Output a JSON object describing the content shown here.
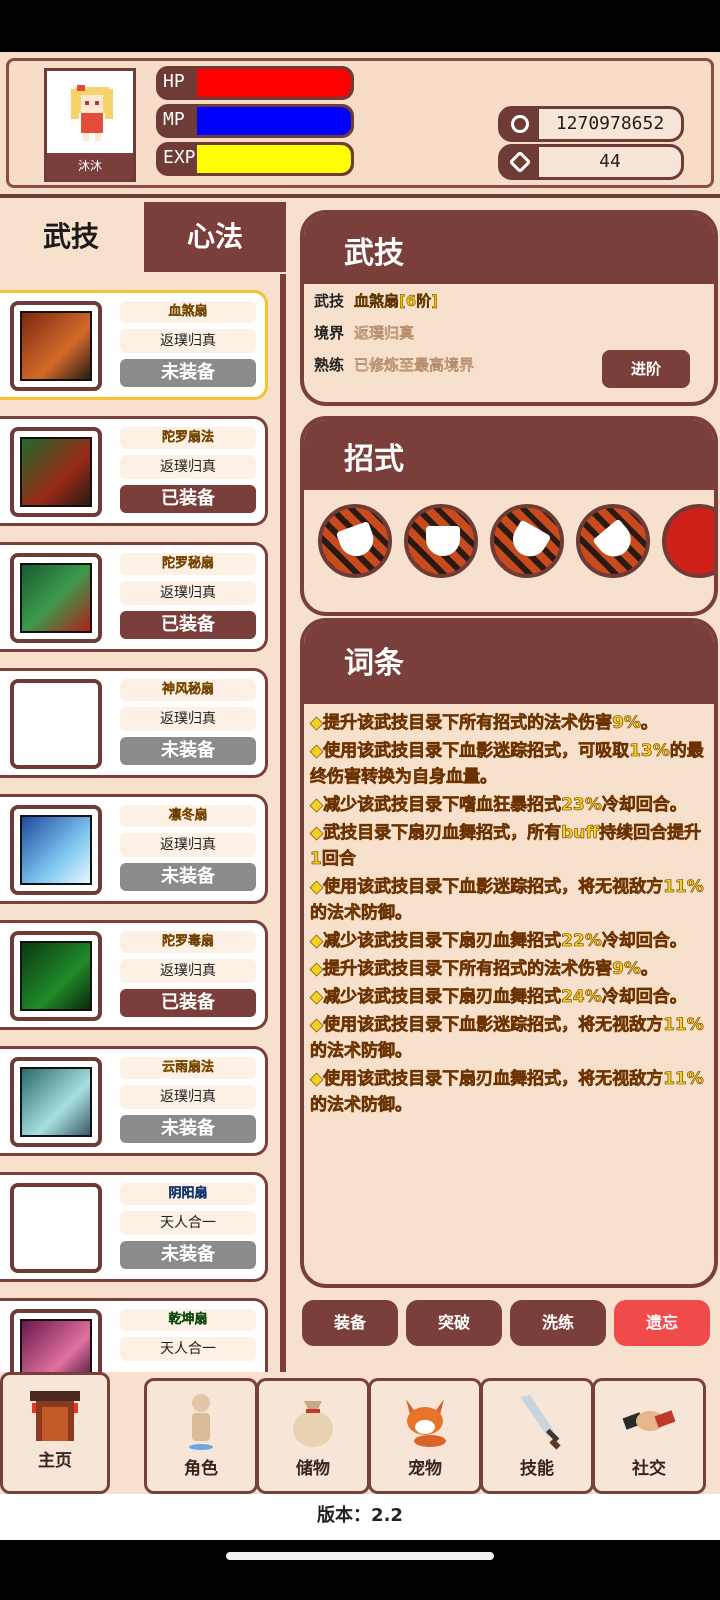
{
  "player": {
    "name": "沐沐",
    "hp_label": "HP",
    "mp_label": "MP",
    "exp_label": "EXP",
    "coins": "1270978652",
    "gems": "44"
  },
  "tabs": {
    "active": "武技",
    "inactive": "心法"
  },
  "skills": [
    {
      "name": "血煞扇",
      "realm": "返璞归真",
      "status": "未装备",
      "equipped": false
    },
    {
      "name": "陀罗扇法",
      "realm": "返璞归真",
      "status": "已装备",
      "equipped": true
    },
    {
      "name": "陀罗秘扇",
      "realm": "返璞归真",
      "status": "已装备",
      "equipped": true
    },
    {
      "name": "神风秘扇",
      "realm": "返璞归真",
      "status": "未装备",
      "equipped": false
    },
    {
      "name": "凛冬扇",
      "realm": "返璞归真",
      "status": "未装备",
      "equipped": false
    },
    {
      "name": "陀罗毒扇",
      "realm": "返璞归真",
      "status": "已装备",
      "equipped": true
    },
    {
      "name": "云雨扇法",
      "realm": "返璞归真",
      "status": "未装备",
      "equipped": false
    },
    {
      "name": "阴阳扇",
      "realm": "天人合一",
      "status": "未装备",
      "equipped": false
    },
    {
      "name": "乾坤扇",
      "realm": "天人合一",
      "status": "",
      "equipped": false
    }
  ],
  "detail": {
    "header": "武技",
    "skill_key": "武技",
    "skill_val": "血煞扇[6阶]",
    "realm_key": "境界",
    "realm_val": "返璞归真",
    "skill_prof_key": "熟练",
    "skill_prof_val": "已修炼至最高境界",
    "advance_btn": "进阶"
  },
  "moves_header": "招式",
  "traits_header": "词条",
  "traits": [
    "◆提升该武技目录下所有招式的法术伤害9%。",
    "◆使用该武技目录下血影迷踪招式，可吸取13%的最终伤害转换为自身血量。",
    "◆减少该武技目录下嗜血狂暴招式23%冷却回合。",
    "◆武技目录下扇刃血舞招式，所有buff持续回合提升1回合",
    "◆使用该武技目录下血影迷踪招式，将无视敌方11%的法术防御。",
    "◆减少该武技目录下扇刃血舞招式22%冷却回合。",
    "◆提升该武技目录下所有招式的法术伤害9%。",
    "◆减少该武技目录下扇刃血舞招式24%冷却回合。",
    "◆使用该武技目录下血影迷踪招式，将无视敌方11%的法术防御。",
    "◆使用该武技目录下扇刃血舞招式，将无视敌方11%的法术防御。"
  ],
  "actions": {
    "equip": "装备",
    "breakthrough": "突破",
    "refine": "洗练",
    "forget": "遗忘"
  },
  "nav": {
    "home": "主页",
    "character": "角色",
    "storage": "储物",
    "pet": "宠物",
    "skill": "技能",
    "social": "社交"
  },
  "version": "版本：2.2",
  "colors": {
    "primary": "#7a3f3a",
    "bg": "#f7e0cc",
    "hp": "#ff0000",
    "mp": "#0000ff",
    "exp": "#ffff00",
    "forget": "#f04a4a"
  }
}
